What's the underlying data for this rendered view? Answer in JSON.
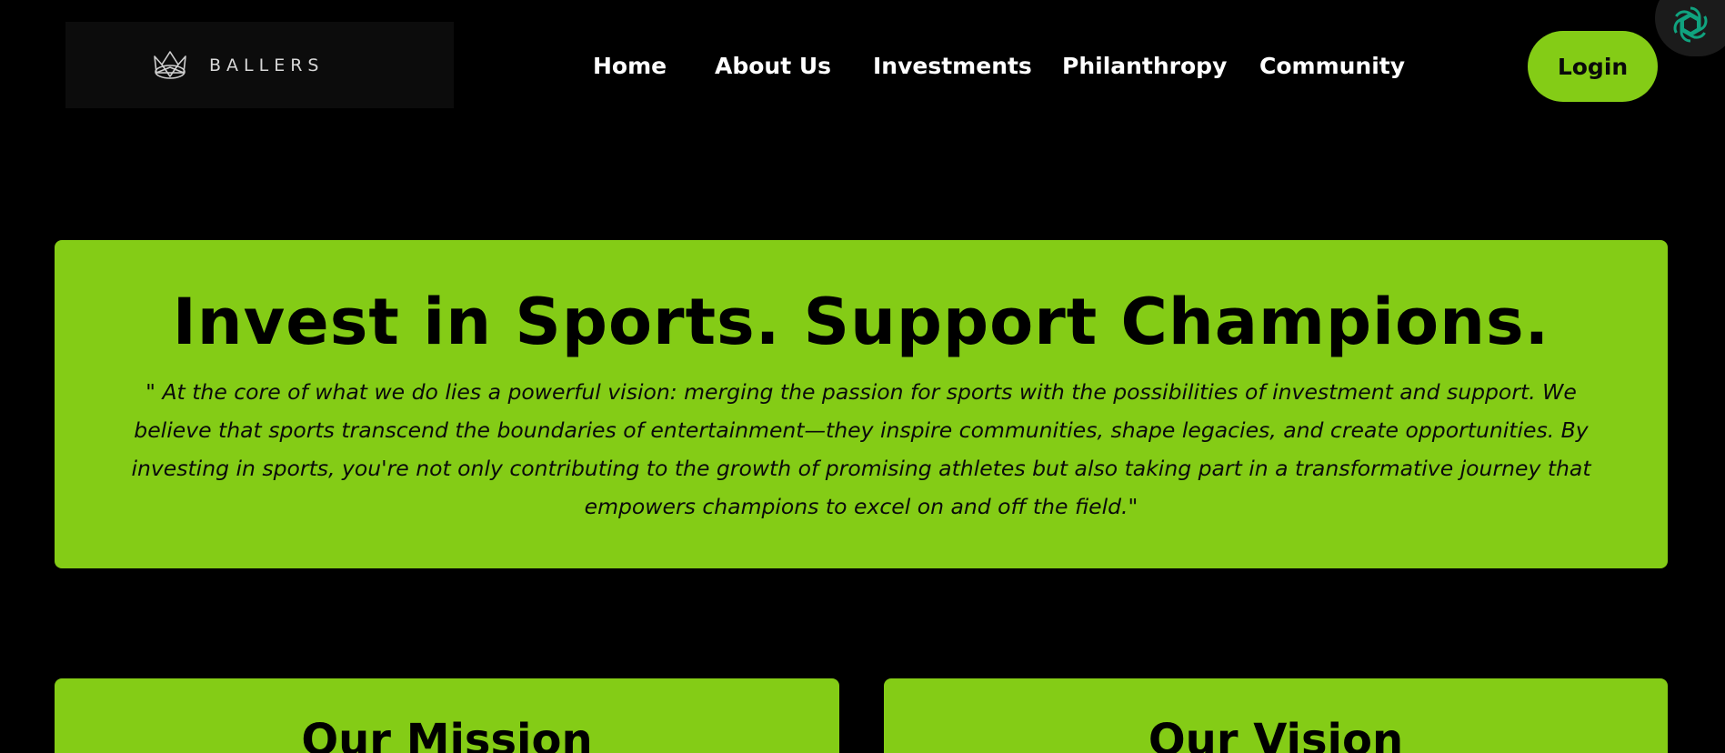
{
  "header": {
    "logo_text": "BALLERS",
    "nav": [
      {
        "label": "Home"
      },
      {
        "label": "About Us"
      },
      {
        "label": "Investments"
      },
      {
        "label": "Philanthropy"
      },
      {
        "label": "Community"
      }
    ],
    "login_label": "Login"
  },
  "hero": {
    "title": "Invest in Sports. Support Champions.",
    "quote": "\" At the core of what we do lies a powerful vision: merging the passion for sports with the possibilities of investment and support. We believe that sports transcend the boundaries of entertainment—they inspire communities, shape legacies, and create opportunities. By investing in sports, you're not only contributing to the growth of promising athletes but also taking part in a transformative journey that empowers champions to excel on and off the field.\""
  },
  "cards": [
    {
      "title": "Our Mission"
    },
    {
      "title": "Our Vision"
    }
  ],
  "colors": {
    "background": "#000000",
    "accent": "#84cc16",
    "nav_text": "#ffffff",
    "widget_icon": "#10a37f"
  },
  "icons": {
    "logo": "crown-logo-icon",
    "corner": "openai-knot-icon"
  }
}
